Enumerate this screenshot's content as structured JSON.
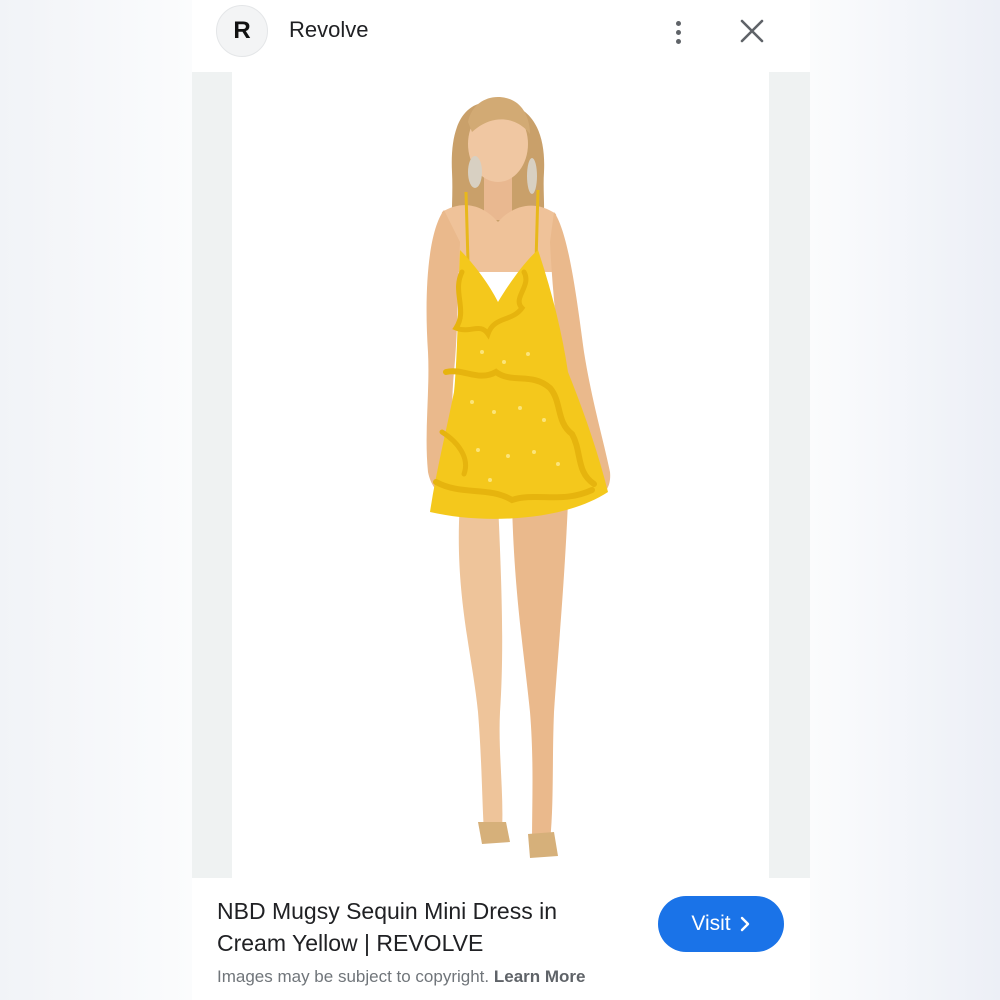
{
  "header": {
    "avatar_letter": "R",
    "site_name": "Revolve",
    "more_icon": "more-vertical-icon",
    "close_icon": "close-icon"
  },
  "image": {
    "subject": "product-photo"
  },
  "footer": {
    "title": "NBD Mugsy Sequin Mini Dress in Cream Yellow | REVOLVE",
    "visit_label": "Visit",
    "visit_icon": "chevron-right-icon",
    "copyright_text": "Images may be subject to copyright.",
    "learn_more_label": "Learn More"
  },
  "colors": {
    "accent": "#1a73e8",
    "dress": "#f4c81c",
    "skin": "#eec49a",
    "hair": "#c9a06a"
  }
}
